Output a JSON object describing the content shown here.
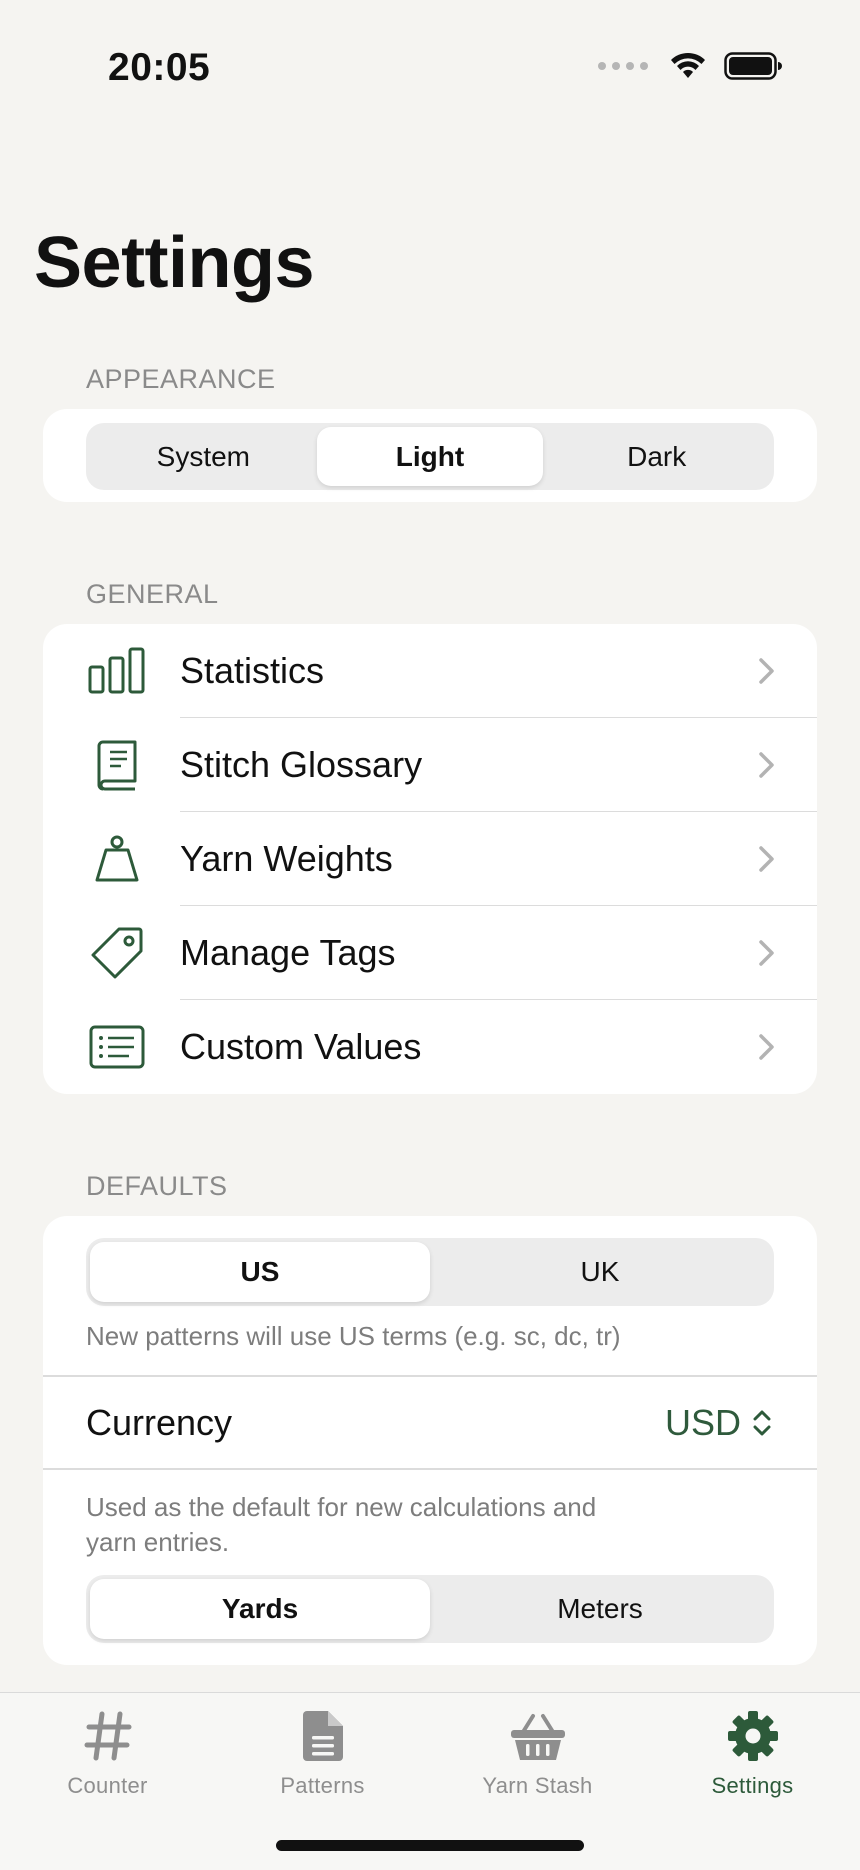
{
  "status_bar": {
    "time": "20:05"
  },
  "page": {
    "title": "Settings"
  },
  "appearance": {
    "header": "APPEARANCE",
    "options": [
      "System",
      "Light",
      "Dark"
    ],
    "selected": "Light"
  },
  "general": {
    "header": "GENERAL",
    "items": [
      {
        "label": "Statistics",
        "icon": "bar-chart-icon"
      },
      {
        "label": "Stitch Glossary",
        "icon": "book-icon"
      },
      {
        "label": "Yarn Weights",
        "icon": "scale-weight-icon"
      },
      {
        "label": "Manage Tags",
        "icon": "tag-icon"
      },
      {
        "label": "Custom Values",
        "icon": "list-icon"
      }
    ]
  },
  "defaults": {
    "header": "DEFAULTS",
    "terms": {
      "options": [
        "US",
        "UK"
      ],
      "selected": "US"
    },
    "terms_hint": "New patterns will use US terms (e.g. sc, dc, tr)",
    "currency": {
      "label": "Currency",
      "value": "USD"
    },
    "units_hint_line1": "Used as the default for new calculations and",
    "units_hint_line2": "yarn entries.",
    "units": {
      "options": [
        "Yards",
        "Meters"
      ],
      "selected": "Yards"
    }
  },
  "tab_bar": {
    "tabs": [
      {
        "label": "Counter",
        "icon": "hash-icon"
      },
      {
        "label": "Patterns",
        "icon": "document-icon"
      },
      {
        "label": "Yarn Stash",
        "icon": "basket-icon"
      },
      {
        "label": "Settings",
        "icon": "gear-icon"
      }
    ],
    "active": "Settings"
  },
  "colors": {
    "accent": "#2d5a3a",
    "background": "#f5f4f1",
    "card": "#ffffff",
    "secondary_text": "#8a8a8a"
  }
}
